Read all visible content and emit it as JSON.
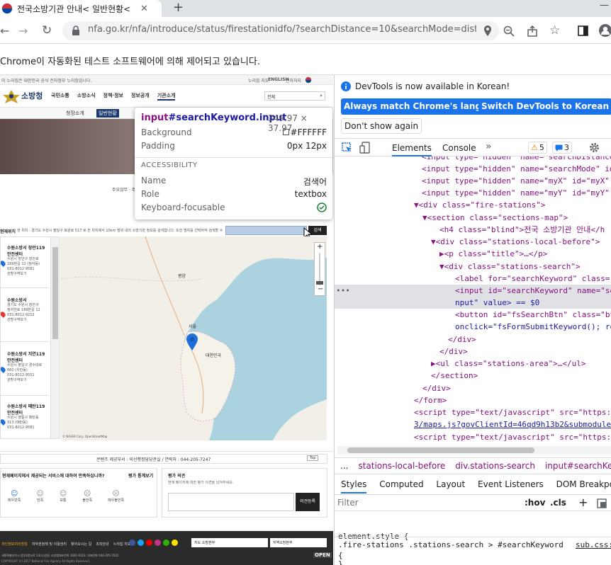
{
  "browser": {
    "tab_title": "전국소방기관 안내< 일반현황<",
    "new_tab": "+",
    "minimize": "—",
    "url": "nfa.go.kr/nfa/introduce/status/firestationidfo/?searchDistance=10&searchMode=dist...",
    "automation_notice": "Chrome이 자동화된 테스트 소프트웨어에 의해 제어되고 있습니다."
  },
  "site": {
    "gov_banner": "이 누리집은 대한민국 공식 전자정부 누리집입니다.",
    "top_links": [
      "누리집 지도",
      "ENGLISH",
      "전자처지"
    ],
    "logo_text": "소방청",
    "gnb": [
      "국민소통",
      "소방소식",
      "정책·정보",
      "정보공개",
      "기관소개"
    ],
    "search_select": "전체",
    "subnav": [
      "청장소개",
      "일반현황"
    ],
    "breadcrumb_fragment": "주요업무 · 주요",
    "location_label": "현재위치",
    "search_desc": "현 위치 : 경기도 수원시 팔달구 효원로 517 로 한 위치에서 10km 범위 내의 소방기관 정보를 검색합니다. 또한 범위를 선택하여 검색할 수 있습니다.",
    "search_button": "검색",
    "stations": [
      {
        "name": "수원소방서 장안119 안전센터",
        "addr": [
          "수원시 장안구 장안로",
          "189번길 12 (정자동)"
        ],
        "tel": "031-8012-9581",
        "link": "관할구역보기"
      },
      {
        "name": "수원소방서",
        "addr": [
          "경기도 수원시 장안구",
          "정자천로 189번길 12",
          "031-8012-9212"
        ],
        "tel": "",
        "link": "관할구역보기"
      },
      {
        "name": "수원소방서 지연119 안전센터",
        "addr": [
          "수원시 팔달구 경수대로",
          "660 (우만동)"
        ],
        "tel": "031-8012-9551",
        "link": "관할구역보기"
      },
      {
        "name": "수원소방서 매탄119 안전센터",
        "addr": [
          "수원시 영통구 매탄동",
          "313 (매탄동)"
        ],
        "tel": "031-8012-9581",
        "link": "관할구역보기"
      }
    ],
    "map_labels": {
      "seoul": "서울",
      "korea": "대한민국",
      "pyongyang": "평양",
      "attribution": "© NAVER Corp. OpenStreetMap"
    },
    "footer_info": "콘텐츠 제공부서 : 의선행정담당관실    /    연락처 : 044-205-7247",
    "top_button": "Top",
    "survey": {
      "question": "현재페이지에서 제공되는 서비스에 대하여 만족하십니까?",
      "stats_link": "평가 통계보기",
      "options": [
        "매우만족",
        "만족",
        "보통",
        "불만족",
        "매우불만족"
      ],
      "opinion_title": "평가 의견",
      "opinion_desc": "현재 페이지에 대한 평가 의견을 남겨주세요.",
      "submit": "의견등록"
    },
    "footer": {
      "links": [
        "개인정보처리방침",
        "저작권정책 및 이용권리",
        "찾아오시는 길",
        "조직안내",
        "누리집 지도"
      ],
      "select1": "지도 소방본부",
      "select2": "지역소방본부",
      "address": "세종특별자치시 정부2청사로 13(나성동) 소방청대표전화 1661-9119, 대표전화 044-205-7022",
      "copyright": "COPYRIGHT (c) 2017 National Fire Agency All Rights Reserved.",
      "open": "OPEN"
    }
  },
  "tooltip": {
    "selector_tag": "input",
    "selector_rest": "#searchKeyword.input",
    "size": "349.97 × 37.97",
    "rows": [
      {
        "label": "Background",
        "value": "#FFFFFF"
      },
      {
        "label": "Padding",
        "value": "0px 12px"
      }
    ],
    "section": "ACCESSIBILITY",
    "a11y": [
      {
        "label": "Name",
        "value": "검색어"
      },
      {
        "label": "Role",
        "value": "textbox"
      },
      {
        "label": "Keyboard-focusable",
        "value": ""
      }
    ]
  },
  "devtools": {
    "notice": "DevTools is now available in Korean!",
    "btn_match": "Always match Chrome's language",
    "btn_switch": "Switch DevTools to Korean",
    "btn_dismiss": "Don't show again",
    "tabs": [
      "Elements",
      "Console"
    ],
    "more": "»",
    "warn_count": "5",
    "msg_count": "3",
    "dom_lines": [
      "<input type=\"hidden\" name=\"searchDistance",
      "<input type=\"hidden\" name=\"searchMode\" id",
      "<input type=\"hidden\" name=\"myX\" id=\"myX\"",
      "<input type=\"hidden\" name=\"myY\" id=\"myY\"",
      "▼<div class=\"fire-stations\">",
      "▼<section class=\"sections-map\">",
      "<h4 class=\"blind\">전국 소방기관 안내</h",
      "▼<div class=\"stations-local-before\">",
      "▶<p class=\"title\">…</p>",
      "▼<div class=\"stations-search\">",
      "<label for=\"searchKeyword\" class=",
      "<input id=\"searchKeyword\" name=\"se",
      "nput\" value> == $0",
      "<button id=\"fsSearchBtn\" class=\"bt",
      "onclick=\"fsFormSubmitKeyword(); re",
      "</div>",
      "</div>",
      "▶<ul class=\"stations-area\">…</ul>",
      "</section>",
      "</div>",
      "</form>",
      "<script type=\"text/javascript\" src=\"https:/",
      "3/maps.js?govClientId=46qd9h13b2&submodules",
      "<script type=\"text/javascript\" src=\"https:/"
    ],
    "breadcrumbs": [
      "...",
      "stations-local-before",
      "div.stations-search",
      "input#searchKeyword.inp"
    ],
    "styles_tabs": [
      "Styles",
      "Computed",
      "Layout",
      "Event Listeners",
      "DOM Breakpoints"
    ],
    "filter_placeholder": "Filter",
    "hov": ":hov",
    "cls": ".cls",
    "element_style": "element.style {",
    "close_brace": "}",
    "rule_selector": ".fire-stations .stations-search > #searchKeyword",
    "rule_source": "sub.css:",
    "open_brace": "{"
  }
}
